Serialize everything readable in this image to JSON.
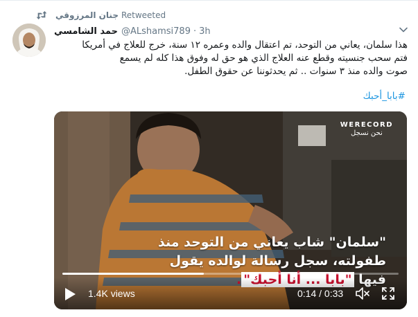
{
  "retweet": {
    "user": "جنان المرزوقي",
    "label": "Retweeted"
  },
  "tweet": {
    "display_name": "حمد الشامسي",
    "handle": "@ALshamsi789",
    "separator": "·",
    "time": "3h",
    "text_lines": [
      "هذا سلمان، يعاني من التوحد، تم اعتقال والده وعمره ١٢ سنة، خرج للعلاج في أمريكا",
      "فتم سحب جنسيته وقطع عنه العلاج الذي هو حق له وفوق هذا كله  لم يسمع",
      "صوت والده منذ ٣ سنوات .. ثم يحدثوننا عن حقوق الطفل."
    ],
    "hashtag": "#بابا_أحبك"
  },
  "video": {
    "brand_line1": "WERECORD",
    "brand_line2": "نحن نسجل",
    "caption_line1": "\"سلمان\" شاب يعاني من التوحد منذ",
    "caption_line2": "طفولته، سجل رسالة لوالده يقول",
    "caption_line3_prefix": "فيها",
    "caption_line3_highlight": "\"بابا ... أنا أحبك\"",
    "caption_line3_suffix": ".",
    "views": "1.4K views",
    "time": "0:14 / 0:33",
    "progress": 0.42
  },
  "icons": {
    "retweet": "retweet-icon",
    "chevron": "chevron-down-icon",
    "play": "play-icon",
    "volume": "volume-icon",
    "fullscreen": "fullscreen-icon"
  },
  "colors": {
    "link": "#1b95e0",
    "secondary_text": "#657786",
    "caption_red": "#c8102e"
  }
}
